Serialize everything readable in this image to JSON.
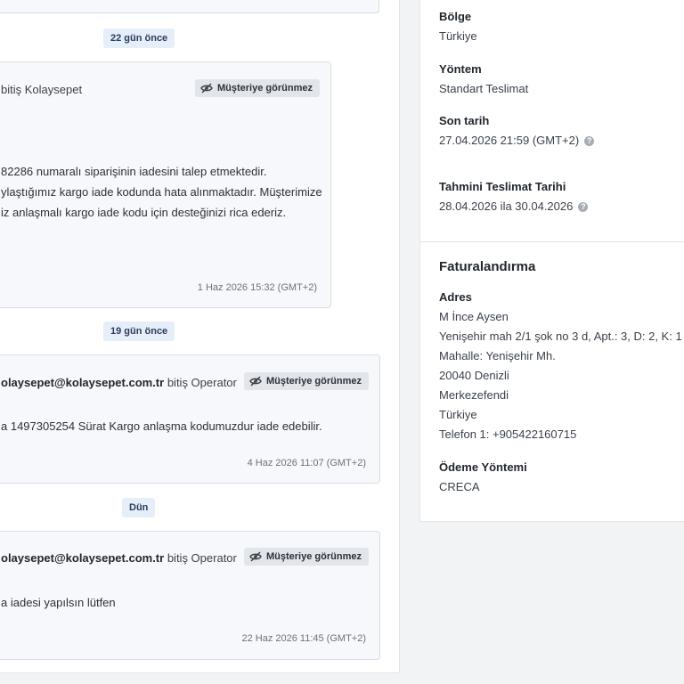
{
  "conversation": {
    "hidden_label": "Müşteriye görünmez",
    "date_separators": [
      "22 gün önce",
      "19 gün önce",
      "Dün"
    ],
    "messages": [
      {
        "sender_tail": "bitiş Kolaysepet",
        "body": [
          "82286 numaralı siparişinin iadesini talep etmektedir.",
          "ylaştığımız kargo iade kodunda hata alınmaktadır. Müşterimize",
          "iz anlaşmalı kargo iade kodu için desteğinizi rica ederiz."
        ],
        "timestamp": "1 Haz 2026 15:32 (GMT+2)"
      },
      {
        "sender_email": "olaysepet@kolaysepet.com.tr",
        "sender_role": "bitiş Operator",
        "body": [
          "a 1497305254 Sürat Kargo anlaşma kodumuzdur iade edebilir."
        ],
        "timestamp": "4 Haz 2026 11:07 (GMT+2)"
      },
      {
        "sender_email": "olaysepet@kolaysepet.com.tr",
        "sender_role": "bitiş Operator",
        "body": [
          "a iadesi yapılsın lütfen"
        ],
        "timestamp": "22 Haz 2026 11:45 (GMT+2)"
      }
    ]
  },
  "delivery": {
    "region_label": "Bölge",
    "region_value": "Türkiye",
    "method_label": "Yöntem",
    "method_value": "Standart Teslimat",
    "deadline_label": "Son tarih",
    "deadline_value": "27.04.2026 21:59 (GMT+2)",
    "estimate_label": "Tahmini Teslimat Tarihi",
    "estimate_value": "28.04.2026 ila 30.04.2026",
    "help_glyph": "?"
  },
  "billing": {
    "title": "Faturalandırma",
    "address_label": "Adres",
    "address_lines": [
      "M İnce Aysen",
      "Yenişehir mah 2/1 şok no 3 d, Apt.: 3, D: 2, K: 1",
      "Mahalle: Yenişehir Mh.",
      "20040 Denizli",
      "Merkezefendi",
      "Türkiye",
      "Telefon 1: +905422160715"
    ],
    "payment_label": "Ödeme Yöntemi",
    "payment_value": "CRECA"
  },
  "icons": {
    "hidden": "eye-slash-icon",
    "help": "question-circle-icon"
  }
}
